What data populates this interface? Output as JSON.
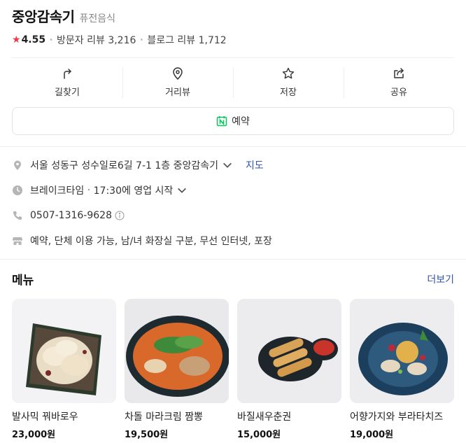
{
  "place": {
    "name": "중앙감속기",
    "category": "퓨전음식",
    "rating": "4.55",
    "visitor_reviews": "방문자 리뷰 3,216",
    "blog_reviews": "블로그 리뷰 1,712"
  },
  "actions": [
    {
      "label": "길찾기",
      "icon": "directions-icon"
    },
    {
      "label": "거리뷰",
      "icon": "location-pin-icon"
    },
    {
      "label": "저장",
      "icon": "star-outline-icon"
    },
    {
      "label": "공유",
      "icon": "share-icon"
    }
  ],
  "reserve": {
    "label": "예약",
    "icon": "naver-calendar-icon"
  },
  "info": {
    "address": "서울 성동구 성수일로6길 7-1 1층 중앙감속기",
    "map_link": "지도",
    "hours_status": "브레이크타임",
    "hours_detail": "17:30에 영업 시작",
    "phone": "0507-1316-9628",
    "amenities": "예약, 단체 이용 가능, 남/녀 화장실 구분, 무선 인터넷, 포장"
  },
  "menu": {
    "title": "메뉴",
    "more": "더보기",
    "items": [
      {
        "name": "발사믹 꿔바로우",
        "price": "23,000원"
      },
      {
        "name": "차돌 마라크림 짬뽕",
        "price": "19,500원"
      },
      {
        "name": "바질새우춘권",
        "price": "15,000원"
      },
      {
        "name": "어향가지와 부라타치즈",
        "price": "19,000원"
      }
    ]
  },
  "colors": {
    "accent_star": "#f0384c",
    "link": "#2f55a4",
    "naver_green": "#03c75a"
  }
}
